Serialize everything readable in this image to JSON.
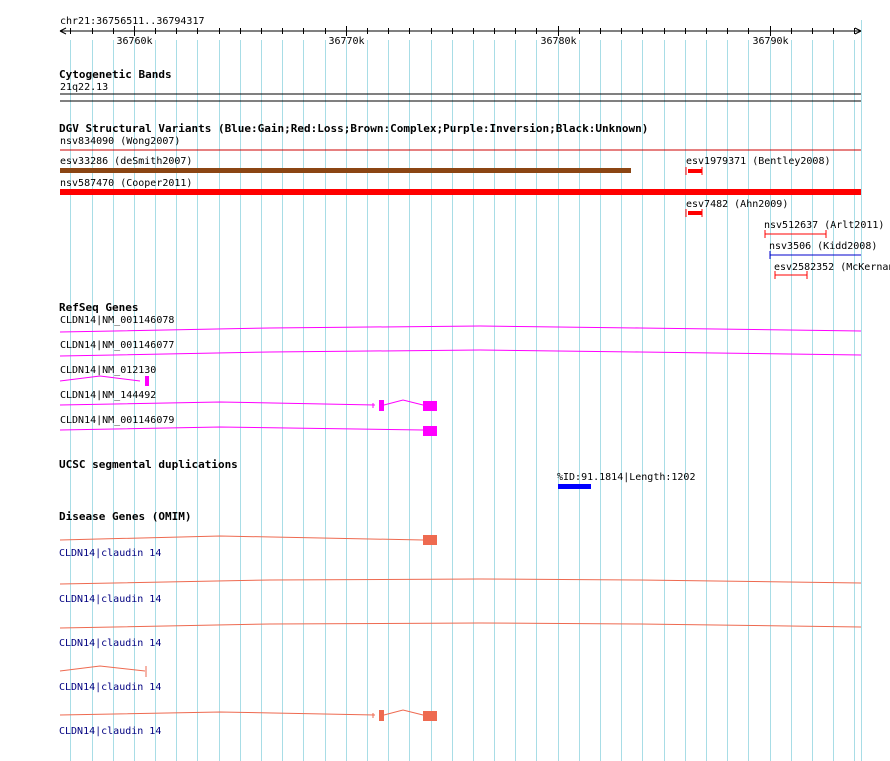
{
  "ruler": {
    "region": "chr21:36756511..36794317",
    "start": 36756511,
    "end": 36794317,
    "ticks": [
      36760000,
      36770000,
      36780000,
      36790000
    ],
    "tick_labels": [
      "36760k",
      "36770k",
      "36780k",
      "36790k"
    ]
  },
  "tracks": {
    "cytoband": {
      "title": "Cytogenetic Bands",
      "band": "21q22.13"
    },
    "dgv": {
      "title": "DGV Structural Variants (Blue:Gain;Red:Loss;Brown:Complex;Purple:Inversion;Black:Unknown)",
      "features": [
        {
          "label": "nsv834090 (Wong2007)",
          "color": "#cc0000"
        },
        {
          "label": "esv33286 (deSmith2007)",
          "color": "#8b4513"
        },
        {
          "label": "esv1979371 (Bentley2008)",
          "color": "#ff0000"
        },
        {
          "label": "nsv587470 (Cooper2011)",
          "color": "#ff0000"
        },
        {
          "label": "esv7482 (Ahn2009)",
          "color": "#ff0000"
        },
        {
          "label": "nsv512637 (Arlt2011)",
          "color": "#ff0000"
        },
        {
          "label": "nsv3506 (Kidd2008)",
          "color": "#0000cc"
        },
        {
          "label": "esv2582352 (McKernan",
          "color": "#ff0000"
        }
      ]
    },
    "refseq": {
      "title": "RefSeq Genes",
      "color": "#ff00ff",
      "genes": [
        {
          "label": "CLDN14|NM_001146078"
        },
        {
          "label": "CLDN14|NM_001146077"
        },
        {
          "label": "CLDN14|NM_012130"
        },
        {
          "label": "CLDN14|NM_144492"
        },
        {
          "label": "CLDN14|NM_001146079"
        }
      ]
    },
    "segdup": {
      "title": "UCSC segmental duplications",
      "label": "%ID:91.1814|Length:1202",
      "color": "#0000ff"
    },
    "omim": {
      "title": "Disease Genes (OMIM)",
      "color": "#ee6a50",
      "genes": [
        {
          "label": "CLDN14|claudin 14"
        },
        {
          "label": "CLDN14|claudin 14"
        },
        {
          "label": "CLDN14|claudin 14"
        },
        {
          "label": "CLDN14|claudin 14"
        },
        {
          "label": "CLDN14|claudin 14"
        }
      ]
    }
  }
}
